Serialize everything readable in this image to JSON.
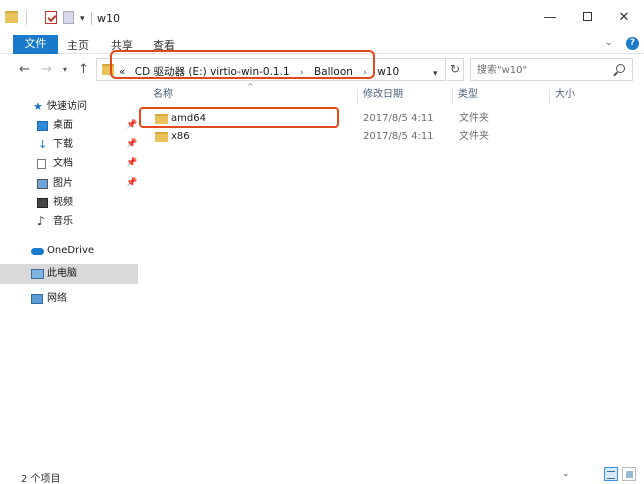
{
  "window": {
    "title": "w10",
    "min_label": "—",
    "max_label": "",
    "close_label": "✕",
    "qat_dropdown": "▾",
    "ribbon_expand": "⌄",
    "help_label": "?"
  },
  "ribbon": {
    "tabs": [
      {
        "label": "文件"
      },
      {
        "label": "主页"
      },
      {
        "label": "共享"
      },
      {
        "label": "查看"
      }
    ]
  },
  "nav": {
    "back": "←",
    "forward": "→",
    "recent": "▾",
    "up": "↑",
    "address": {
      "prefix": "«",
      "crumbs": [
        "CD 驱动器 (E:) virtio-win-0.1.1",
        "Balloon",
        "w10"
      ],
      "separator": "›",
      "dropdown": "▾",
      "refresh": "↻"
    },
    "search": {
      "placeholder": "搜索\"w10\""
    }
  },
  "sidebar": {
    "quick_access": "快速访问",
    "items": [
      {
        "label": "桌面",
        "icon": "desktop-icon",
        "pinned": true
      },
      {
        "label": "下载",
        "icon": "download-icon",
        "pinned": true
      },
      {
        "label": "文档",
        "icon": "document-icon",
        "pinned": true
      },
      {
        "label": "图片",
        "icon": "picture-icon",
        "pinned": true
      },
      {
        "label": "视频",
        "icon": "video-icon",
        "pinned": false
      },
      {
        "label": "音乐",
        "icon": "music-icon",
        "pinned": false
      }
    ],
    "pin_glyph": "📌",
    "onedrive": "OneDrive",
    "this_pc": "此电脑",
    "network": "网络"
  },
  "content": {
    "sort_indicator": "^",
    "columns": [
      "名称",
      "修改日期",
      "类型",
      "大小"
    ],
    "rows": [
      {
        "name": "amd64",
        "date": "2017/8/5 4:11",
        "type": "文件夹",
        "size": ""
      },
      {
        "name": "x86",
        "date": "2017/8/5 4:11",
        "type": "文件夹",
        "size": ""
      }
    ]
  },
  "status": {
    "count": "2 个项目",
    "chevron": "⌄"
  },
  "colors": {
    "accent": "#1979ca",
    "highlight": "#e24a1c",
    "folder": "#e9c15a",
    "selected_nav": "#d9d9d9"
  }
}
